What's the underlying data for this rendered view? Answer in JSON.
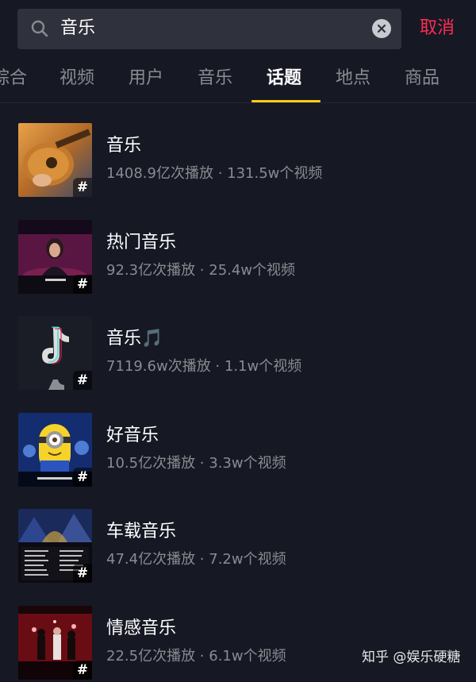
{
  "search": {
    "query": "音乐"
  },
  "cancel_label": "取消",
  "tabs": [
    {
      "label": "综合"
    },
    {
      "label": "视频"
    },
    {
      "label": "用户"
    },
    {
      "label": "音乐"
    },
    {
      "label": "话题"
    },
    {
      "label": "地点"
    },
    {
      "label": "商品"
    }
  ],
  "active_tab": "话题",
  "results": [
    {
      "title": "音乐",
      "stats": "1408.9亿次播放 · 131.5w个视频",
      "badge": "#",
      "icon": "guitar-thumbnail"
    },
    {
      "title": "热门音乐",
      "stats": "92.3亿次播放 · 25.4w个视频",
      "badge": "#",
      "icon": "singer-thumbnail"
    },
    {
      "title": "音乐🎵",
      "stats": "7119.6w次播放 · 1.1w个视频",
      "badge": "#",
      "icon": "tiktok-logo-thumbnail"
    },
    {
      "title": "好音乐",
      "stats": "10.5亿次播放 · 3.3w个视频",
      "badge": "#",
      "icon": "minion-thumbnail"
    },
    {
      "title": "车载音乐",
      "stats": "47.4亿次播放 · 7.2w个视频",
      "badge": "#",
      "icon": "concert-playlist-thumbnail"
    },
    {
      "title": "情感音乐",
      "stats": "22.5亿次播放 · 6.1w个视频",
      "badge": "#",
      "icon": "stage-band-thumbnail"
    }
  ],
  "watermark": "知乎 @娱乐硬糖",
  "colors": {
    "background": "#161823",
    "accent": "#face15",
    "cancel": "#fe2c55",
    "muted": "#8a8b91"
  }
}
